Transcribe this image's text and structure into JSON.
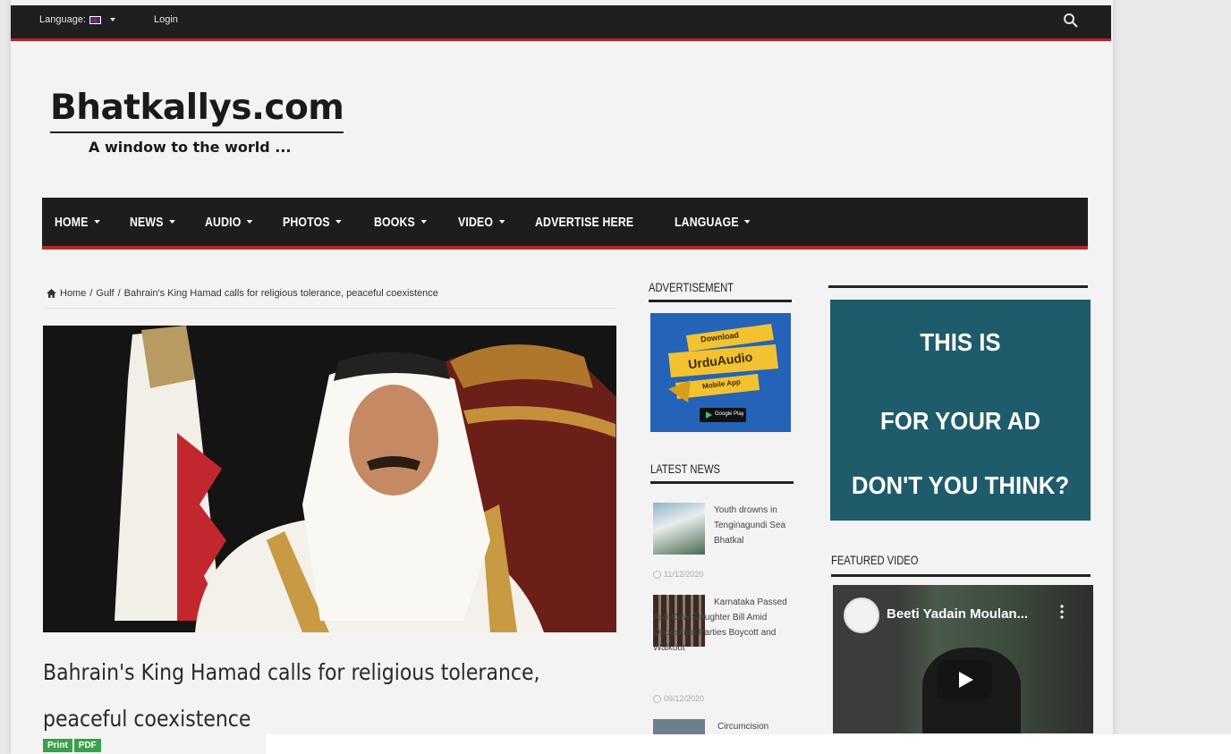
{
  "topbar": {
    "language_label": "Language:",
    "login_label": "Login"
  },
  "logo": {
    "title": "Bhatkallys.com",
    "tagline": "A window to the world ..."
  },
  "nav": {
    "items": [
      {
        "label": "HOME",
        "dropdown": true
      },
      {
        "label": "NEWS",
        "dropdown": true
      },
      {
        "label": "AUDIO",
        "dropdown": true
      },
      {
        "label": "PHOTOS",
        "dropdown": true
      },
      {
        "label": "BOOKS",
        "dropdown": true
      },
      {
        "label": "VIDEO",
        "dropdown": true
      },
      {
        "label": "ADVERTISE HERE",
        "dropdown": false
      },
      {
        "label": "LANGUAGE",
        "dropdown": true
      }
    ]
  },
  "breadcrumb": {
    "home": "Home",
    "sep1": "/",
    "category": "Gulf",
    "sep2": "/",
    "current": "Bahrain's King Hamad calls for religious tolerance, peaceful coexistence"
  },
  "article": {
    "headline": "Bahrain's King Hamad calls for religious tolerance, peaceful coexistence",
    "print_label": "Print",
    "pdf_label": "PDF"
  },
  "sidebar": {
    "advertisement_title": "ADVERTISEMENT",
    "urdu_ad": {
      "line1": "Download",
      "line2": "UrduAudio",
      "line3": "Mobile App",
      "store": "Google Play"
    },
    "latest_news_title": "LATEST NEWS",
    "latest_news": [
      {
        "title": "Youth drowns in Tenginagundi Sea Bhatkal",
        "date": "11/12/2020"
      },
      {
        "title": "Karnataka Passed Anti-Cow Slaughter Bill Amid Opposition Parties Boycott and Walkout",
        "date": "09/12/2020"
      },
      {
        "title": "Circumcision",
        "date": ""
      }
    ]
  },
  "right": {
    "ad_lines": [
      "THIS IS",
      "FOR YOUR AD",
      "DON'T YOU THINK?"
    ],
    "featured_video_title": "FEATURED VIDEO",
    "video_title": "Beeti Yadain Moulan..."
  },
  "colors": {
    "accent_red": "#b3282d",
    "nav_bg": "#1d1d1d",
    "ad_teal": "#1f5c6b",
    "urdu_ad_blue": "#2563b8",
    "urdu_ad_yellow": "#f2c230",
    "print_green": "#3aa04c"
  }
}
